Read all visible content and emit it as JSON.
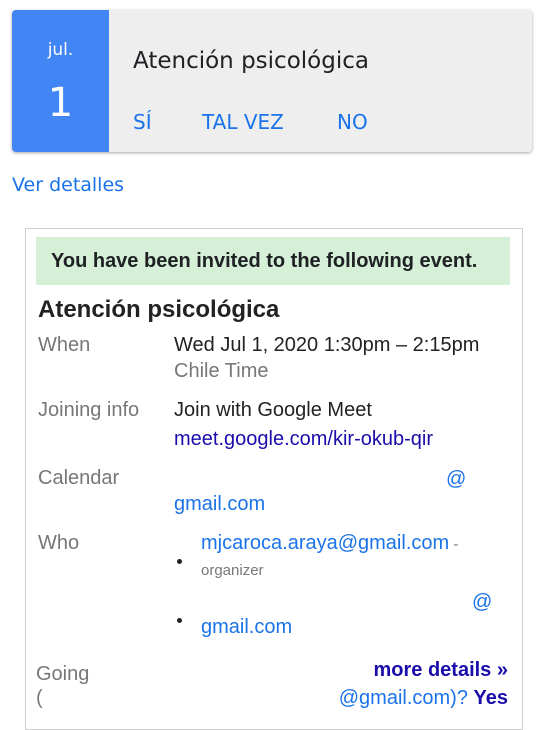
{
  "event_card": {
    "month": "jul.",
    "day": "1",
    "title": "Atención psicológica",
    "rsvp": {
      "yes": "SÍ",
      "maybe": "TAL VEZ",
      "no": "NO"
    }
  },
  "view_details": "Ver detalles",
  "mail": {
    "banner": "You have been invited to the following event.",
    "title": "Atención psicológica",
    "when": {
      "label": "When",
      "value": "Wed Jul 1, 2020 1:30pm – 2:15pm",
      "timezone": "Chile Time"
    },
    "joining": {
      "label": "Joining info",
      "value": "Join with Google Meet",
      "link": "meet.google.com/kir-okub-qir"
    },
    "calendar": {
      "label": "Calendar",
      "at": "@",
      "domain": "gmail.com"
    },
    "who": {
      "label": "Who",
      "organizer_email": "mjcaroca.araya@gmail.com",
      "organizer_dash": " -",
      "organizer_tag": "organizer",
      "guest_at": "@",
      "guest_domain": "gmail.com"
    },
    "more_details": "more details »",
    "going": {
      "label": "Going",
      "paren": "(",
      "line": "@gmail.com)?",
      "yes": "Yes"
    }
  },
  "colors": {
    "date_block": "#4285f4",
    "card_bg": "#eeeeee",
    "banner_bg": "#d6f0d8",
    "accent": "#1a73e8",
    "link": "#1a0dab"
  }
}
